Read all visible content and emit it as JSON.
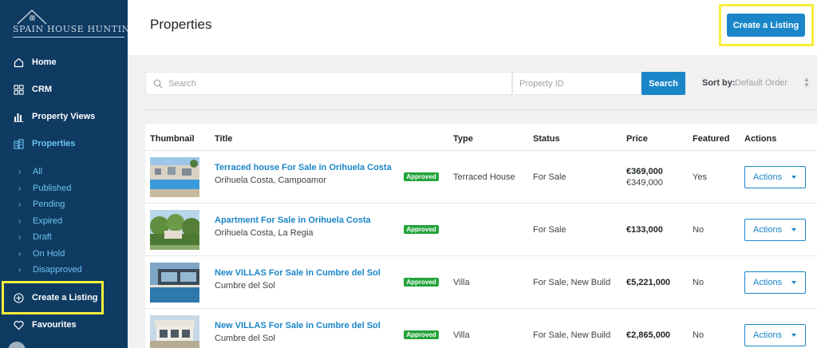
{
  "brand": {
    "name": "SPAIN HOUSE HUNTING"
  },
  "sidebar": {
    "items": [
      {
        "label": "Home",
        "icon": "home-icon"
      },
      {
        "label": "CRM",
        "icon": "grid-icon"
      },
      {
        "label": "Property Views",
        "icon": "bar-chart-icon"
      },
      {
        "label": "Properties",
        "icon": "building-icon",
        "active": true
      }
    ],
    "sub_items": [
      "All",
      "Published",
      "Pending",
      "Expired",
      "Draft",
      "On Hold",
      "Disapproved"
    ],
    "create": {
      "label": "Create a Listing",
      "icon": "plus-circle-icon"
    },
    "favourites": {
      "label": "Favourites",
      "icon": "heart-icon"
    }
  },
  "header": {
    "title": "Properties",
    "create_button": "Create a Listing"
  },
  "filters": {
    "search_placeholder": "Search",
    "property_id_placeholder": "Property ID",
    "search_button": "Search",
    "sort_label": "Sort by:",
    "sort_value": "Default Order"
  },
  "table": {
    "columns": [
      "Thumbnail",
      "Title",
      "Type",
      "Status",
      "Price",
      "Featured",
      "Actions"
    ],
    "rows": [
      {
        "title": "Terraced house For Sale in Orihuela Costa",
        "location": "Orihuela Costa, Campoamor",
        "badge": "Approved",
        "type": "Terraced House",
        "status": "For Sale",
        "price": "€369,000",
        "price_old": "€349,000",
        "featured": "Yes",
        "action": "Actions"
      },
      {
        "title": "Apartment For Sale in Orihuela Costa",
        "location": "Orihuela Costa, La Regia",
        "badge": "Approved",
        "type": "",
        "status": "For Sale",
        "price": "€133,000",
        "price_old": "",
        "featured": "No",
        "action": "Actions"
      },
      {
        "title": "New VILLAS For Sale in Cumbre del Sol",
        "location": "Cumbre del Sol",
        "badge": "Approved",
        "type": "Villa",
        "status": "For Sale, New Build",
        "price": "€5,221,000",
        "price_old": "",
        "featured": "No",
        "action": "Actions"
      },
      {
        "title": "New VILLAS For Sale in Cumbre del Sol",
        "location": "Cumbre del Sol",
        "badge": "Approved",
        "type": "Villa",
        "status": "For Sale, New Build",
        "price": "€2,865,000",
        "price_old": "",
        "featured": "No",
        "action": "Actions"
      }
    ]
  },
  "colors": {
    "sidebar": "#0f3b63",
    "accent": "#1a86c8",
    "approved": "#23a33b",
    "highlight": "#f6ee3a"
  }
}
